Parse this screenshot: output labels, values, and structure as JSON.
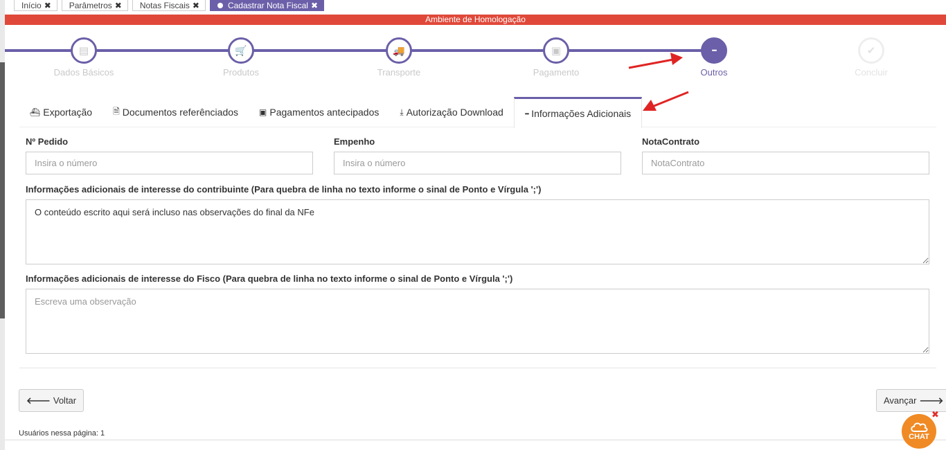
{
  "top_tabs": [
    {
      "label": "Início"
    },
    {
      "label": "Parâmetros"
    },
    {
      "label": "Notas Fiscais"
    },
    {
      "label": "Cadastrar Nota Fiscal"
    }
  ],
  "close_glyph": "✖",
  "environment_banner": "Ambiente de Homologação",
  "stepper": {
    "steps": [
      {
        "label": "Dados Básicos",
        "icon": "list-icon",
        "glyph": "▤"
      },
      {
        "label": "Produtos",
        "icon": "cart-icon",
        "glyph": "🛒"
      },
      {
        "label": "Transporte",
        "icon": "truck-icon",
        "glyph": "🚚"
      },
      {
        "label": "Pagamento",
        "icon": "money-icon",
        "glyph": "▣"
      },
      {
        "label": "Outros",
        "icon": "ellipsis-icon",
        "glyph": "•••"
      },
      {
        "label": "Concluir",
        "icon": "check-icon",
        "glyph": "✔"
      }
    ],
    "current_step": "Outros"
  },
  "inner_tabs": [
    {
      "label": "Exportação",
      "icon": "ship-icon",
      "glyph": "⛴"
    },
    {
      "label": "Documentos referênciados",
      "icon": "document-icon",
      "glyph": "🗎"
    },
    {
      "label": "Pagamentos antecipados",
      "icon": "money-icon",
      "glyph": "▣"
    },
    {
      "label": "Autorização Download",
      "icon": "download-icon",
      "glyph": "⤓"
    },
    {
      "label": "Informações Adicionais",
      "icon": "ellipsis-icon",
      "glyph": "•••"
    }
  ],
  "active_inner_tab": "Informações Adicionais",
  "form": {
    "pedido_label": "Nº Pedido",
    "pedido_placeholder": "Insira o número",
    "empenho_label": "Empenho",
    "empenho_placeholder": "Insira o número",
    "contrato_label": "NotaContrato",
    "contrato_placeholder": "NotaContrato",
    "contribuinte_label": "Informações adicionais de interesse do contribuinte (Para quebra de linha no texto informe o sinal de Ponto e Vírgula ';')",
    "contribuinte_value": "O conteúdo escrito aqui será incluso nas observações do final da NFe",
    "fisco_label": "Informações adicionais de interesse do Fisco (Para quebra de linha no texto informe o sinal de Ponto e Vírgula ';')",
    "fisco_placeholder": "Escreva uma observação"
  },
  "buttons": {
    "back_label": "Voltar",
    "next_label": "Avançar"
  },
  "footer": {
    "users_text": "Usuários nessa página: 1"
  },
  "chat": {
    "label": "CHAT"
  },
  "colors": {
    "accent": "#6a5fa8",
    "banner": "#e0493a",
    "annotation_arrow": "#e02424",
    "chat": "#f08a24"
  }
}
